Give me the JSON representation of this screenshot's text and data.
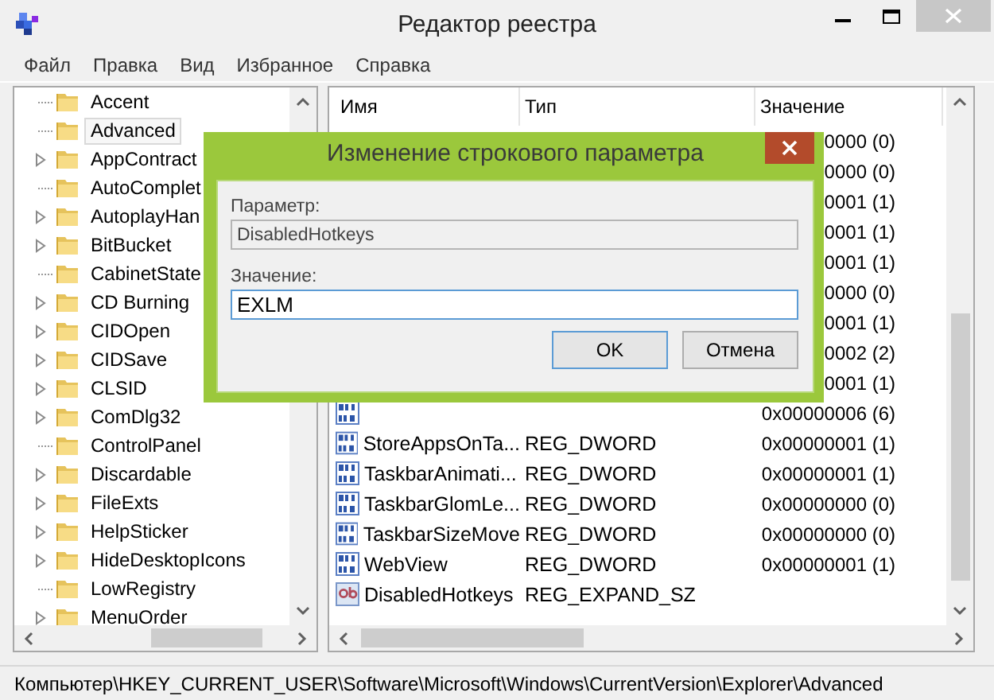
{
  "window": {
    "title": "Редактор реестра"
  },
  "menu": [
    "Файл",
    "Правка",
    "Вид",
    "Избранное",
    "Справка"
  ],
  "tree": {
    "items": [
      {
        "label": "Accent",
        "expandable": false,
        "selected": false
      },
      {
        "label": "Advanced",
        "expandable": false,
        "selected": true
      },
      {
        "label": "AppContract",
        "expandable": true,
        "selected": false
      },
      {
        "label": "AutoComplet",
        "expandable": false,
        "selected": false
      },
      {
        "label": "AutoplayHan",
        "expandable": true,
        "selected": false
      },
      {
        "label": "BitBucket",
        "expandable": true,
        "selected": false
      },
      {
        "label": "CabinetState",
        "expandable": false,
        "selected": false
      },
      {
        "label": "CD Burning",
        "expandable": true,
        "selected": false
      },
      {
        "label": "CIDOpen",
        "expandable": true,
        "selected": false
      },
      {
        "label": "CIDSave",
        "expandable": true,
        "selected": false
      },
      {
        "label": "CLSID",
        "expandable": true,
        "selected": false
      },
      {
        "label": "ComDlg32",
        "expandable": true,
        "selected": false
      },
      {
        "label": "ControlPanel",
        "expandable": false,
        "selected": false
      },
      {
        "label": "Discardable",
        "expandable": true,
        "selected": false
      },
      {
        "label": "FileExts",
        "expandable": true,
        "selected": false
      },
      {
        "label": "HelpSticker",
        "expandable": true,
        "selected": false
      },
      {
        "label": "HideDesktopIcons",
        "expandable": true,
        "selected": false
      },
      {
        "label": "LowRegistry",
        "expandable": false,
        "selected": false
      },
      {
        "label": "MenuOrder",
        "expandable": true,
        "selected": false
      }
    ]
  },
  "list": {
    "columns": [
      "Имя",
      "Тип",
      "Значение"
    ],
    "rows": [
      {
        "value": "0000 (0)"
      },
      {
        "value": "0000 (0)"
      },
      {
        "value": "0001 (1)"
      },
      {
        "value": "0001 (1)"
      },
      {
        "value": "0001 (1)"
      },
      {
        "value": "0000 (0)"
      },
      {
        "value": "0001 (1)"
      },
      {
        "value": "0002 (2)"
      },
      {
        "value": "0001 (1)"
      },
      {
        "kind": "dword",
        "value": "0x00000006 (6)"
      },
      {
        "kind": "dword",
        "name": "StoreAppsOnTa...",
        "type": "REG_DWORD",
        "value": "0x00000001 (1)"
      },
      {
        "kind": "dword",
        "name": "TaskbarAnimati...",
        "type": "REG_DWORD",
        "value": "0x00000001 (1)"
      },
      {
        "kind": "dword",
        "name": "TaskbarGlomLe...",
        "type": "REG_DWORD",
        "value": "0x00000000 (0)"
      },
      {
        "kind": "dword",
        "name": "TaskbarSizeMove",
        "type": "REG_DWORD",
        "value": "0x00000000 (0)"
      },
      {
        "kind": "dword",
        "name": "WebView",
        "type": "REG_DWORD",
        "value": "0x00000001 (1)"
      },
      {
        "kind": "string",
        "name": "DisabledHotkeys",
        "type": "REG_EXPAND_SZ"
      }
    ]
  },
  "dialog": {
    "title": "Изменение строкового параметра",
    "name_label": "Параметр:",
    "name_value": "DisabledHotkeys",
    "value_label": "Значение:",
    "value": "EXLM",
    "buttons": [
      {
        "label": "OK",
        "default": true
      },
      {
        "label": "Отмена",
        "default": false
      }
    ]
  },
  "status_bar": "Компьютер\\HKEY_CURRENT_USER\\Software\\Microsoft\\Windows\\CurrentVersion\\Explorer\\Advanced"
}
